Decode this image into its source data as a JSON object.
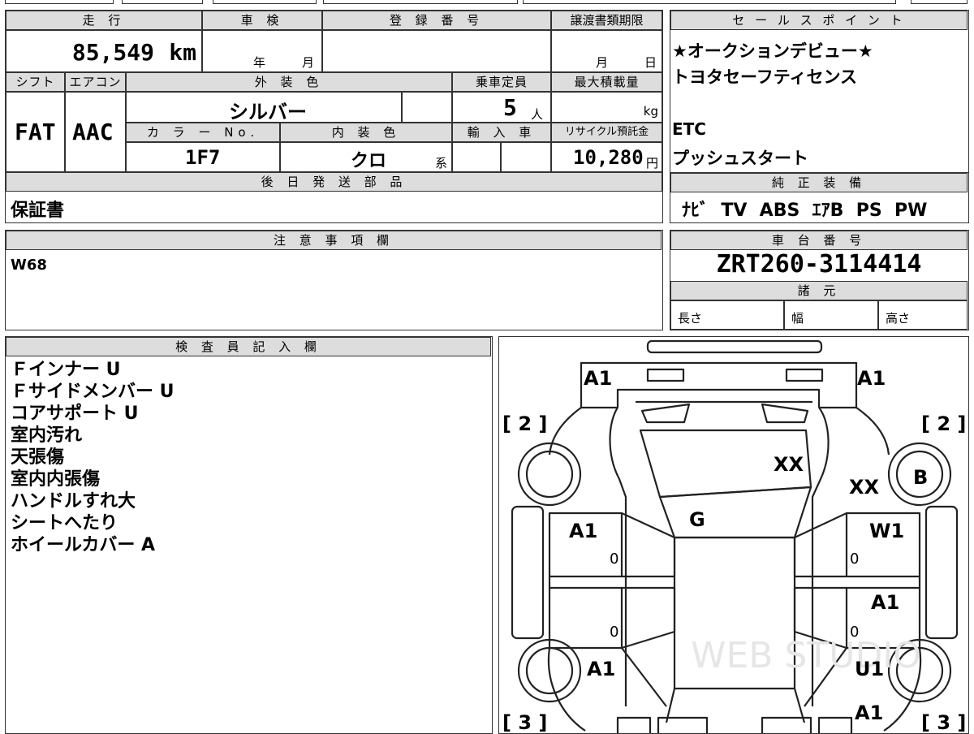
{
  "left_table": {
    "mileage_label": "走 行",
    "mileage_value": "85,549",
    "mileage_unit": "km",
    "shaken_label": "車 検",
    "shaken_year": "年",
    "shaken_month": "月",
    "reg_label": "登 録 番 号",
    "transfer_label": "譲渡書類期限",
    "transfer_month": "月",
    "transfer_day": "日",
    "shift_label": "シフト",
    "ac_label": "エアコン",
    "exterior_label": "外 装 色",
    "capacity_label": "乗車定員",
    "maxload_label": "最大積載量",
    "shift_value": "FAT",
    "ac_value": "AAC",
    "exterior_value": "シルバー",
    "capacity_value": "5",
    "capacity_unit": "人",
    "maxload_unit": "kg",
    "color_no_label": "カ ラ ー No.",
    "interior_label": "内 装 色",
    "import_label": "輸 入 車",
    "recycle_label": "リサイクル預託金",
    "color_no_value": "1F7",
    "interior_value": "クロ",
    "interior_suffix": "系",
    "recycle_value": "10,280",
    "recycle_unit": "円",
    "parts_label": "後 日 発 送 部 品",
    "parts_value": "保証書"
  },
  "sales_points": {
    "label": "セ ー ル ス ポ イ ン ト",
    "lines": [
      "★オークションデビュー★",
      "トヨタセーフティセンス",
      "",
      "ETC",
      "プッシュスタート"
    ]
  },
  "genuine_equipment": {
    "label": "純 正 装 備",
    "value": "ﾅﾋﾞ  TV  ABS  ｴｱB  PS  PW"
  },
  "notes": {
    "label": "注 意 事 項 欄",
    "value": "W68"
  },
  "chassis": {
    "label": "車 台 番 号",
    "value": "ZRT260-3114414",
    "spec_label": "諸 元",
    "length_label": "長さ",
    "width_label": "幅",
    "height_label": "高さ"
  },
  "inspector": {
    "label": "検 査 員 記 入 欄",
    "lines": [
      "Ｆインナー U",
      "Ｆサイドメンバー U",
      "コアサポート U",
      "室内汚れ",
      "天張傷",
      "室内内張傷",
      "ハンドルすれ大",
      "シートへたり",
      "ホイールカバー A"
    ]
  },
  "diagram": {
    "codes": {
      "front_left_corner": "A1",
      "front_right_corner": "A1",
      "bonnet": "XX",
      "right_fender": "XX",
      "right_front_wheel": "B",
      "windshield": "G",
      "left_front_door": "A1",
      "left_front_door_zero": "0",
      "right_front_door": "W1",
      "right_front_door_zero": "0",
      "left_rear_door_zero": "0",
      "right_rear_door": "A1",
      "right_rear_door_zero": "0",
      "left_rear_fender": "A1",
      "right_rear_fender": "U1",
      "right_rear_corner": "A1"
    },
    "side_marks": {
      "front_left": "[ 2 ]",
      "front_right": "[ 2 ]",
      "rear_left": "[ 3 ]",
      "rear_right": "[ 3 ]"
    },
    "watermark": "WEB STUDIO"
  }
}
